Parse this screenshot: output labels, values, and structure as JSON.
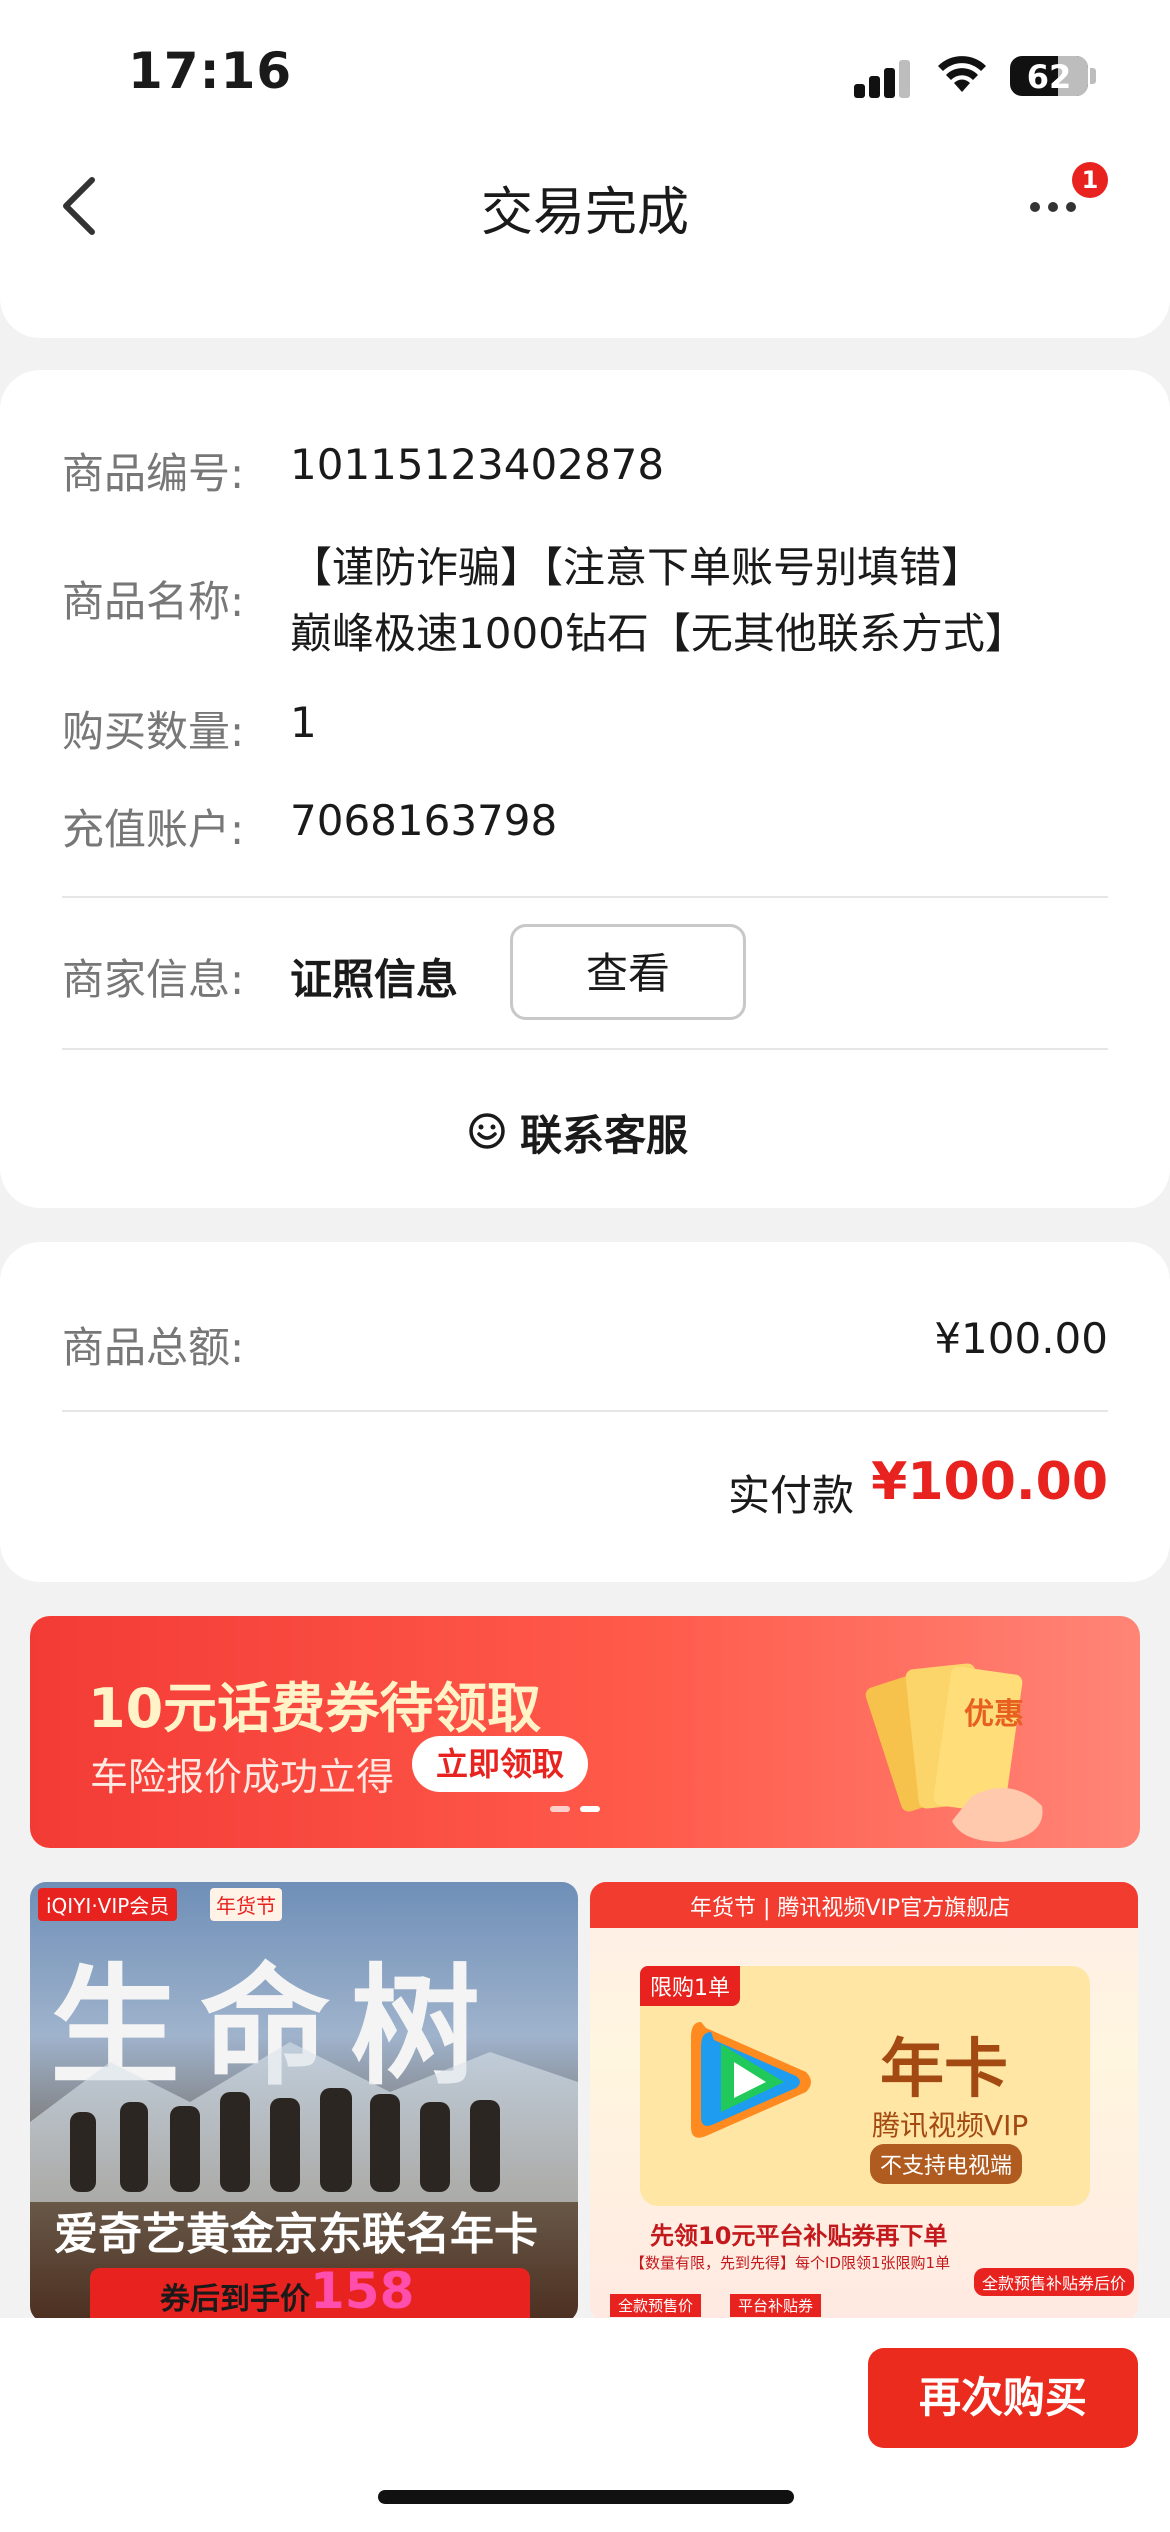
{
  "status_bar": {
    "time": "17:16",
    "battery": "62"
  },
  "header": {
    "title": "交易完成",
    "badge_count": "1"
  },
  "order": {
    "fields": [
      {
        "label": "商品编号:",
        "value": "10115123402878"
      },
      {
        "label": "商品名称:",
        "value_lines": [
          "【谨防诈骗】【注意下单账号别填错】",
          "巅峰极速1000钻石【无其他联系方式】"
        ]
      },
      {
        "label": "购买数量:",
        "value": "1"
      },
      {
        "label": "充值账户:",
        "value": "7068163798"
      }
    ],
    "merchant": {
      "label": "商家信息:",
      "value": "证照信息",
      "button": "查看"
    },
    "contact_service": "联系客服"
  },
  "totals": {
    "goods_total_label": "商品总额:",
    "goods_total_value": "¥100.00",
    "paid_label": "实付款",
    "paid_value": "¥100.00"
  },
  "banner": {
    "title": "10元话费券待领取",
    "subtitle": "车险报价成功立得",
    "button": "立即领取",
    "badge_text": "优惠"
  },
  "products": [
    {
      "brand_tag": "iQIYI·VIP会员",
      "fest_tag": "年货节",
      "hero_text": "生命树",
      "name": "爱奇艺黄金京东联名年卡",
      "price_prefix": "券后到手价",
      "price": "158"
    },
    {
      "header": "年货节 | 腾讯视频VIP官方旗舰店",
      "limit_tag": "限购1单",
      "card_title": "年卡",
      "card_sub": "腾讯视频VIP",
      "card_note": "不支持电视端",
      "promo": "先领10元平台补贴券再下单",
      "promo_sub": "【数量有限，先到先得】每个ID限领1张限购1单",
      "price_tag": "全款预售补贴券后价",
      "footer_left": "全款预售价",
      "footer_mid": "平台补贴券"
    }
  ],
  "bottom_bar": {
    "rebuy": "再次购买"
  },
  "colors": {
    "accent": "#e8231f",
    "banner": "#f33b36"
  }
}
